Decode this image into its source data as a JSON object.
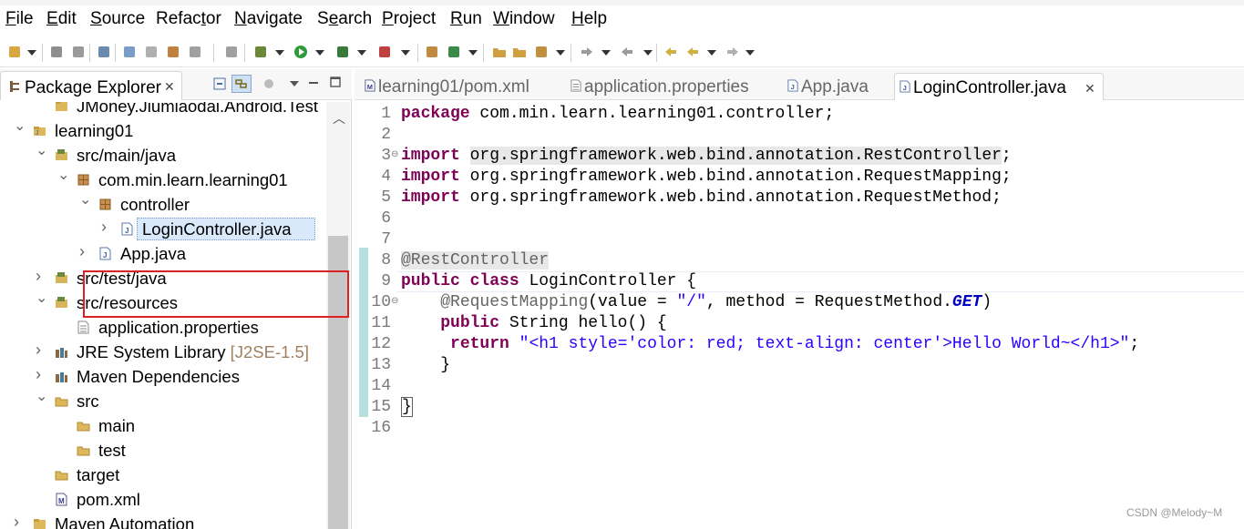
{
  "menubar": {
    "items": [
      {
        "label": "File",
        "mnemonic_index": 0
      },
      {
        "label": "Edit",
        "mnemonic_index": 0
      },
      {
        "label": "Source",
        "mnemonic_index": 0
      },
      {
        "label": "Refactor",
        "mnemonic_index": 5
      },
      {
        "label": "Navigate",
        "mnemonic_index": 0
      },
      {
        "label": "Search",
        "mnemonic_index": 1
      },
      {
        "label": "Project",
        "mnemonic_index": 0
      },
      {
        "label": "Run",
        "mnemonic_index": 0
      },
      {
        "label": "Window",
        "mnemonic_index": 0
      },
      {
        "label": "Help",
        "mnemonic_index": 0
      }
    ]
  },
  "toolbar": {
    "icons": [
      "new-icon",
      "save-icon",
      "save-all-icon",
      "skip-breakpoints-icon",
      "open-type-icon",
      "edit-icon",
      "task-icon",
      "print-icon",
      "show-whitespace-icon",
      "debug-icon",
      "run-icon",
      "coverage-icon",
      "external-tools-icon",
      "new-java-package-icon",
      "new-class-icon",
      "open-folder-icon",
      "open-project-icon",
      "pin-icon",
      "next-annotation-icon",
      "prev-annotation-icon",
      "last-edit-icon",
      "back-icon",
      "forward-icon"
    ]
  },
  "package_explorer": {
    "tab_label": "Package Explorer",
    "tree": [
      {
        "label": "JMoney.Jiumiaodai.Android.Test",
        "icon": "project-icon",
        "expanded": null
      },
      {
        "label": "learning01",
        "icon": "java-project-icon",
        "expanded": true
      },
      {
        "label": "src/main/java",
        "icon": "source-folder-icon",
        "expanded": true
      },
      {
        "label": "com.min.learn.learning01",
        "icon": "package-icon",
        "expanded": true
      },
      {
        "label": "controller",
        "icon": "package-icon",
        "expanded": true
      },
      {
        "label": "LoginController.java",
        "icon": "java-file-icon",
        "expanded": false,
        "selected": true
      },
      {
        "label": "App.java",
        "icon": "java-file-icon",
        "expanded": false
      },
      {
        "label": "src/test/java",
        "icon": "source-folder-icon",
        "expanded": false
      },
      {
        "label": "src/resources",
        "icon": "source-folder-icon",
        "expanded": true
      },
      {
        "label": "application.properties",
        "icon": "properties-file-icon",
        "expanded": null
      },
      {
        "label": "JRE System Library",
        "decoration": "[J2SE-1.5]",
        "icon": "library-icon",
        "expanded": false
      },
      {
        "label": "Maven Dependencies",
        "icon": "library-icon",
        "expanded": false
      },
      {
        "label": "src",
        "icon": "folder-icon",
        "expanded": true
      },
      {
        "label": "main",
        "icon": "folder-icon",
        "expanded": null
      },
      {
        "label": "test",
        "icon": "folder-icon",
        "expanded": null
      },
      {
        "label": "target",
        "icon": "folder-icon",
        "expanded": null
      },
      {
        "label": "pom.xml",
        "icon": "xml-file-icon",
        "expanded": null
      },
      {
        "label": "Maven Automation",
        "icon": "project-icon",
        "expanded": false
      }
    ]
  },
  "editor": {
    "tabs": [
      {
        "label": "learning01/pom.xml",
        "active": false
      },
      {
        "label": "application.properties",
        "active": false
      },
      {
        "label": "App.java",
        "active": false
      },
      {
        "label": "LoginController.java",
        "active": true
      }
    ],
    "lines": [
      {
        "n": "1",
        "text": "package com.min.learn.learning01.controller;"
      },
      {
        "n": "2",
        "text": ""
      },
      {
        "n": "3",
        "text": "import org.springframework.web.bind.annotation.RestController;"
      },
      {
        "n": "4",
        "text": "import org.springframework.web.bind.annotation.RequestMapping;"
      },
      {
        "n": "5",
        "text": "import org.springframework.web.bind.annotation.RequestMethod;"
      },
      {
        "n": "6",
        "text": ""
      },
      {
        "n": "7",
        "text": ""
      },
      {
        "n": "8",
        "text": "@RestController"
      },
      {
        "n": "9",
        "text": "public class LoginController {"
      },
      {
        "n": "10",
        "text": "    @RequestMapping(value = \"/\", method = RequestMethod.GET)"
      },
      {
        "n": "11",
        "text": "    public String hello() {"
      },
      {
        "n": "12",
        "text": "     return \"<h1 style='color: red; text-align: center'>Hello World~</h1>\";"
      },
      {
        "n": "13",
        "text": "    }"
      },
      {
        "n": "14",
        "text": ""
      },
      {
        "n": "15",
        "text": "}"
      },
      {
        "n": "16",
        "text": ""
      }
    ],
    "fold_markers": [
      "3",
      "10"
    ]
  },
  "watermark": "CSDN @Melody~M",
  "colors": {
    "keyword": "#7f0055",
    "annotation": "#646464",
    "string": "#2a00ff",
    "constant": "#0000c0",
    "highlight_box": "#e02020",
    "selection": "#d9e8fb"
  }
}
